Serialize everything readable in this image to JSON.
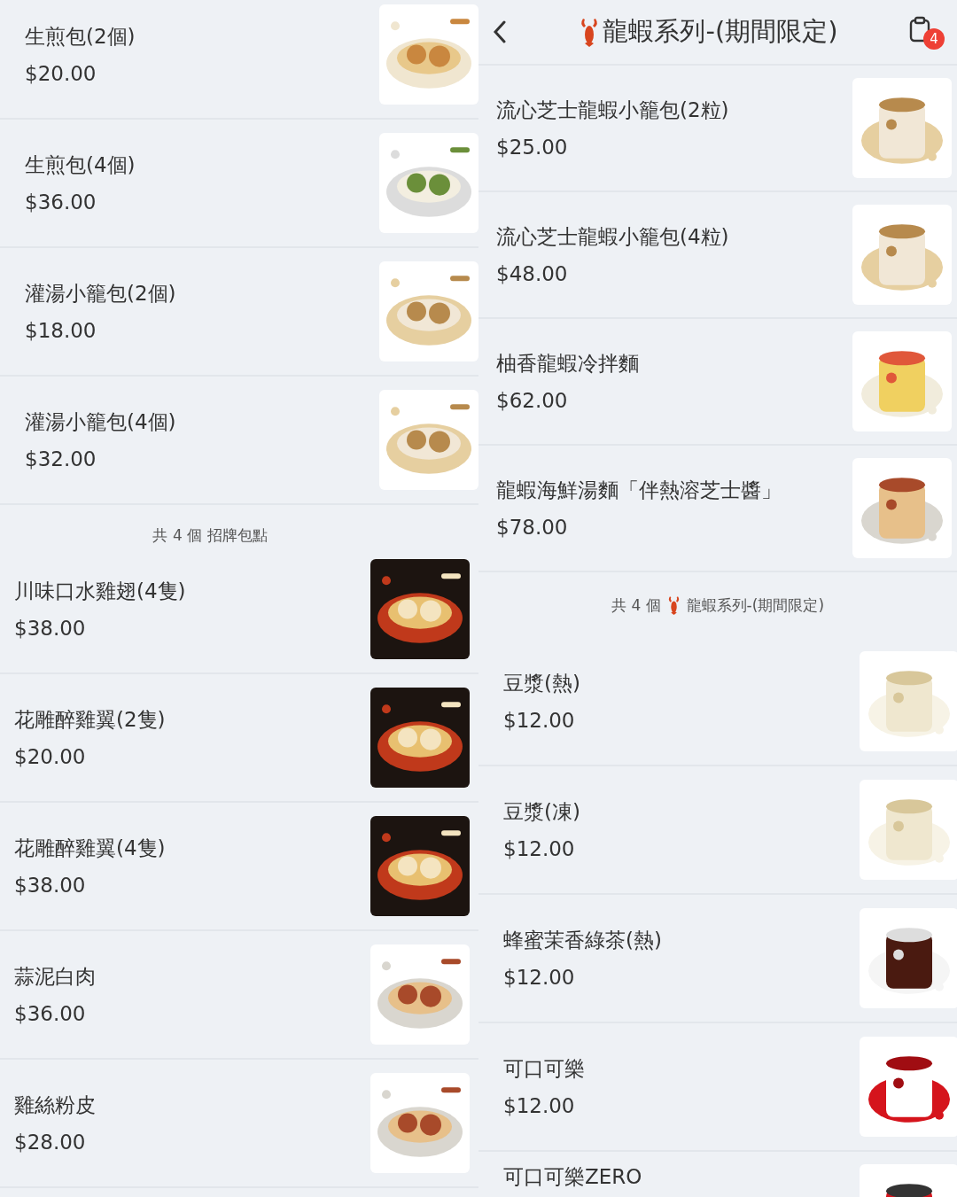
{
  "left_panel": {
    "sections": [
      {
        "items": [
          {
            "name": "生煎包(2個)",
            "price": "$20.00"
          },
          {
            "name": "生煎包(4個)",
            "price": "$36.00"
          },
          {
            "name": "灌湯小籠包(2個)",
            "price": "$18.00"
          },
          {
            "name": "灌湯小籠包(4個)",
            "price": "$32.00"
          }
        ],
        "footer": "共 4 個 招牌包點"
      },
      {
        "items": [
          {
            "name": "川味口水雞翅(4隻)",
            "price": "$38.00"
          },
          {
            "name": "花雕醉雞翼(2隻)",
            "price": "$20.00"
          },
          {
            "name": "花雕醉雞翼(4隻)",
            "price": "$38.00"
          },
          {
            "name": "蒜泥白肉",
            "price": "$36.00"
          },
          {
            "name": "雞絲粉皮",
            "price": "$28.00"
          }
        ]
      }
    ]
  },
  "right_panel": {
    "header": {
      "title": "龍蝦系列-(期間限定)",
      "cart_count": "4"
    },
    "sections": [
      {
        "items": [
          {
            "name": "流心芝士龍蝦小籠包(2粒)",
            "price": "$25.00"
          },
          {
            "name": "流心芝士龍蝦小籠包(4粒)",
            "price": "$48.00"
          },
          {
            "name": "柚香龍蝦冷拌麵",
            "price": "$62.00"
          },
          {
            "name": "龍蝦海鮮湯麵「伴熱溶芝士醬」",
            "price": "$78.00"
          }
        ],
        "footer_count": "共 4 個",
        "footer_title": "龍蝦系列-(期間限定)"
      },
      {
        "items": [
          {
            "name": "豆漿(熱)",
            "price": "$12.00"
          },
          {
            "name": "豆漿(凍)",
            "price": "$12.00"
          },
          {
            "name": "蜂蜜茉香綠茶(熱)",
            "price": "$12.00"
          },
          {
            "name": "可口可樂",
            "price": "$12.00"
          },
          {
            "name": "可口可樂ZERO"
          }
        ]
      }
    ]
  }
}
